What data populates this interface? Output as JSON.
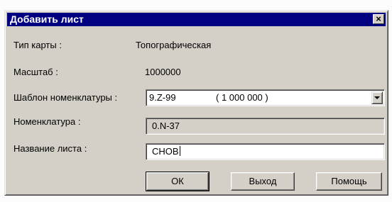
{
  "window": {
    "title": "Добавить лист",
    "close_glyph": "×"
  },
  "fields": {
    "map_type_label": "Тип карты  :",
    "map_type_value": "Топографическая",
    "scale_label": "Масштаб  :",
    "scale_value": "1000000",
    "template_label": "Шаблон номенклатуры :",
    "template_code": "9.Z-99",
    "template_scale": "( 1 000 000 )",
    "nomenclature_label": "Номенклатура :",
    "nomenclature_value": "0.N-37",
    "sheet_name_label": "Название листа :",
    "sheet_name_value": "СНОВ"
  },
  "buttons": {
    "ok": "ОК",
    "exit": "Выход",
    "help": "Помощь"
  },
  "icons": {
    "close": "close-icon",
    "dropdown": "chevron-down-icon"
  }
}
